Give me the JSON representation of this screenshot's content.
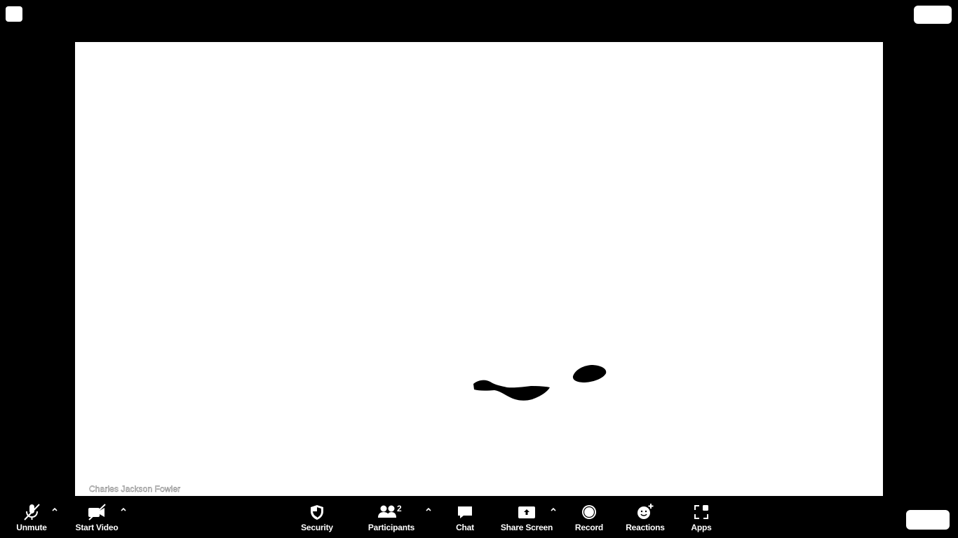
{
  "video": {
    "participant_name": "Charles Jackson Fowler"
  },
  "toolbar": {
    "unmute_label": "Unmute",
    "start_video_label": "Start Video",
    "security_label": "Security",
    "participants_label": "Participants",
    "participants_count": "2",
    "chat_label": "Chat",
    "share_screen_label": "Share Screen",
    "record_label": "Record",
    "reactions_label": "Reactions",
    "apps_label": "Apps"
  },
  "icons": {
    "unmute": "microphone-muted-icon",
    "video": "video-camera-muted-icon",
    "security": "shield-icon",
    "participants": "people-icon",
    "chat": "chat-bubble-icon",
    "share": "share-screen-icon",
    "record": "record-icon",
    "reactions": "smiley-plus-icon",
    "apps": "apps-icon"
  },
  "colors": {
    "background": "#000000",
    "video_background": "#ffffff",
    "foreground": "#ffffff"
  }
}
